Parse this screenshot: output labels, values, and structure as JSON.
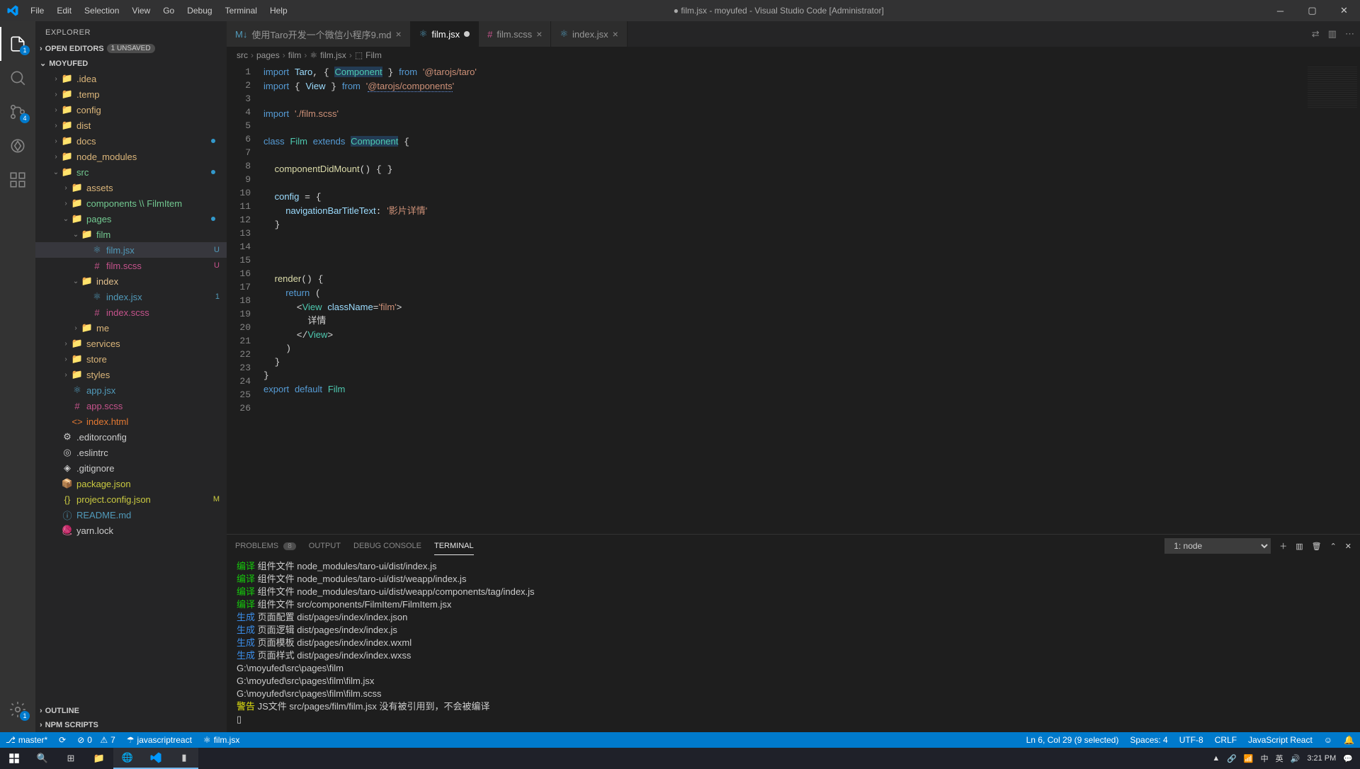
{
  "titlebar": {
    "menu": [
      "File",
      "Edit",
      "Selection",
      "View",
      "Go",
      "Debug",
      "Terminal",
      "Help"
    ],
    "title": "● film.jsx - moyufed - Visual Studio Code [Administrator]"
  },
  "activity": {
    "explorer_badge": "1",
    "scm_badge": "4",
    "gear_badge": "1"
  },
  "sidebar": {
    "header": "EXPLORER",
    "openEditors": {
      "label": "OPEN EDITORS",
      "unsaved": "1 UNSAVED"
    },
    "project": "MOYUFED",
    "outline": "OUTLINE",
    "npm": "NPM SCRIPTS",
    "tree": [
      {
        "indent": 1,
        "chev": "›",
        "icon": "📁",
        "name": ".idea",
        "cls": "folder-icon"
      },
      {
        "indent": 1,
        "chev": "›",
        "icon": "📁",
        "name": ".temp",
        "cls": "folder-icon"
      },
      {
        "indent": 1,
        "chev": "›",
        "icon": "📁",
        "name": "config",
        "cls": "folder-icon"
      },
      {
        "indent": 1,
        "chev": "›",
        "icon": "📁",
        "name": "dist",
        "cls": "folder-icon"
      },
      {
        "indent": 1,
        "chev": "›",
        "icon": "📁",
        "name": "docs",
        "cls": "folder-icon",
        "dot": true
      },
      {
        "indent": 1,
        "chev": "›",
        "icon": "📁",
        "name": "node_modules",
        "cls": "folder-icon"
      },
      {
        "indent": 1,
        "chev": "⌄",
        "icon": "📁",
        "name": "src",
        "cls": "folder-icon green",
        "dot": true
      },
      {
        "indent": 2,
        "chev": "›",
        "icon": "📁",
        "name": "assets",
        "cls": "folder-icon"
      },
      {
        "indent": 2,
        "chev": "›",
        "icon": "📁",
        "name": "components \\\\ FilmItem",
        "cls": "folder-icon green"
      },
      {
        "indent": 2,
        "chev": "⌄",
        "icon": "📁",
        "name": "pages",
        "cls": "folder-icon green",
        "dot": true
      },
      {
        "indent": 3,
        "chev": "⌄",
        "icon": "📁",
        "name": "film",
        "cls": "folder-icon green"
      },
      {
        "indent": 4,
        "chev": "",
        "icon": "⚛",
        "name": "film.jsx",
        "cls": "jsx-file green",
        "status": "U",
        "active": true
      },
      {
        "indent": 4,
        "chev": "",
        "icon": "#",
        "name": "film.scss",
        "cls": "scss-file green",
        "status": "U"
      },
      {
        "indent": 3,
        "chev": "⌄",
        "icon": "📁",
        "name": "index",
        "cls": "folder-icon orange"
      },
      {
        "indent": 4,
        "chev": "",
        "icon": "⚛",
        "name": "index.jsx",
        "cls": "jsx-file red",
        "status": "1"
      },
      {
        "indent": 4,
        "chev": "",
        "icon": "#",
        "name": "index.scss",
        "cls": "scss-file"
      },
      {
        "indent": 3,
        "chev": "›",
        "icon": "📁",
        "name": "me",
        "cls": "folder-icon"
      },
      {
        "indent": 2,
        "chev": "›",
        "icon": "📁",
        "name": "services",
        "cls": "folder-icon"
      },
      {
        "indent": 2,
        "chev": "›",
        "icon": "📁",
        "name": "store",
        "cls": "folder-icon"
      },
      {
        "indent": 2,
        "chev": "›",
        "icon": "📁",
        "name": "styles",
        "cls": "folder-icon"
      },
      {
        "indent": 2,
        "chev": "",
        "icon": "⚛",
        "name": "app.jsx",
        "cls": "jsx-file"
      },
      {
        "indent": 2,
        "chev": "",
        "icon": "#",
        "name": "app.scss",
        "cls": "scss-file"
      },
      {
        "indent": 2,
        "chev": "",
        "icon": "<>",
        "name": "index.html",
        "cls": "html-file"
      },
      {
        "indent": 1,
        "chev": "",
        "icon": "⚙",
        "name": ".editorconfig",
        "cls": ""
      },
      {
        "indent": 1,
        "chev": "",
        "icon": "◎",
        "name": ".eslintrc",
        "cls": ""
      },
      {
        "indent": 1,
        "chev": "",
        "icon": "◈",
        "name": ".gitignore",
        "cls": ""
      },
      {
        "indent": 1,
        "chev": "",
        "icon": "📦",
        "name": "package.json",
        "cls": "json-file"
      },
      {
        "indent": 1,
        "chev": "",
        "icon": "{}",
        "name": "project.config.json",
        "cls": "json-file orange",
        "status": "M"
      },
      {
        "indent": 1,
        "chev": "",
        "icon": "ⓘ",
        "name": "README.md",
        "cls": "md-file"
      },
      {
        "indent": 1,
        "chev": "",
        "icon": "🧶",
        "name": "yarn.lock",
        "cls": ""
      }
    ]
  },
  "tabs": [
    {
      "icon": "M↓",
      "label": "使用Taro开发一个微信小程序9.md",
      "cls": "md-file",
      "close": true
    },
    {
      "icon": "⚛",
      "label": "film.jsx",
      "cls": "jsx-file",
      "modified": true,
      "active": true
    },
    {
      "icon": "#",
      "label": "film.scss",
      "cls": "scss-file",
      "close": true
    },
    {
      "icon": "⚛",
      "label": "index.jsx",
      "cls": "jsx-file",
      "close": true
    }
  ],
  "breadcrumb": [
    "src",
    "pages",
    "film",
    "film.jsx",
    "Film"
  ],
  "breadcrumb_icons": [
    "",
    "",
    "",
    "⚛",
    "⬚"
  ],
  "code": {
    "lines": 26
  },
  "panel": {
    "tabs": {
      "problems": "PROBLEMS",
      "problems_count": "8",
      "output": "OUTPUT",
      "debug": "DEBUG CONSOLE",
      "terminal": "TERMINAL"
    },
    "selector": "1: node",
    "terminal_lines": [
      {
        "p": "编译",
        "t": "组件文件",
        "f": "node_modules/taro-ui/dist/index.js"
      },
      {
        "p": "编译",
        "t": "组件文件",
        "f": "node_modules/taro-ui/dist/weapp/index.js"
      },
      {
        "p": "编译",
        "t": "组件文件",
        "f": "node_modules/taro-ui/dist/weapp/components/tag/index.js"
      },
      {
        "p": "编译",
        "t": "组件文件",
        "f": "src/components/FilmItem/FilmItem.jsx"
      },
      {
        "p": "生成",
        "t": "页面配置",
        "f": "dist/pages/index/index.json"
      },
      {
        "p": "生成",
        "t": "页面逻辑",
        "f": "dist/pages/index/index.js"
      },
      {
        "p": "生成",
        "t": "页面模板",
        "f": "dist/pages/index/index.wxml"
      },
      {
        "p": "生成",
        "t": "页面样式",
        "f": "dist/pages/index/index.wxss"
      }
    ],
    "terminal_tail": [
      "G:\\moyufed\\src\\pages\\film",
      "G:\\moyufed\\src\\pages\\film\\film.jsx",
      "G:\\moyufed\\src\\pages\\film\\film.scss"
    ],
    "terminal_warn": {
      "p": "警告",
      "t": "JS文件",
      "f": "src/pages/film/film.jsx 没有被引用到，不会被编译"
    }
  },
  "statusbar": {
    "left": {
      "branch": "master*",
      "sync": "",
      "errors": "0",
      "warnings": "7",
      "lang_icon": "☂",
      "lang": "javascriptreact",
      "file_icon": "⚛",
      "file": "film.jsx"
    },
    "right": {
      "ln": "Ln 6, Col 29 (9 selected)",
      "spaces": "Spaces: 4",
      "enc": "UTF-8",
      "eol": "CRLF",
      "langmode": "JavaScript React",
      "feedback": "☺",
      "bell": "🔔"
    }
  },
  "taskbar": {
    "time": "3:21 PM",
    "date": "",
    "tray": [
      "▲",
      "🔗",
      "📶",
      "中",
      "英",
      "🔊"
    ]
  }
}
